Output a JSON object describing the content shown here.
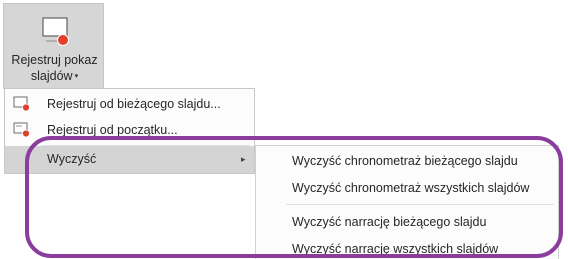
{
  "ribbon": {
    "button_line1": "Rejestruj pokaz",
    "button_line2": "slajdów",
    "caret": "▾",
    "icon": "record-slide-show-icon"
  },
  "menu": {
    "items": [
      {
        "label": "Rejestruj od bieżącego slajdu...",
        "icon": "record-from-current-icon"
      },
      {
        "label": "Rejestruj od początku...",
        "icon": "record-from-beginning-icon"
      },
      {
        "label": "Wyczyść",
        "arrow": "▸"
      }
    ]
  },
  "submenu": {
    "items": [
      {
        "label": "Wyczyść chronometraż bieżącego slajdu"
      },
      {
        "label": "Wyczyść chronometraż wszystkich slajdów"
      },
      {
        "label": "Wyczyść narrację bieżącego slajdu"
      },
      {
        "label": "Wyczyść narrację wszystkich slajdów"
      }
    ]
  },
  "colors": {
    "record_red": "#e0412b",
    "highlight_purple": "#8a3d9c",
    "hover_gray": "#d4d4d4"
  }
}
